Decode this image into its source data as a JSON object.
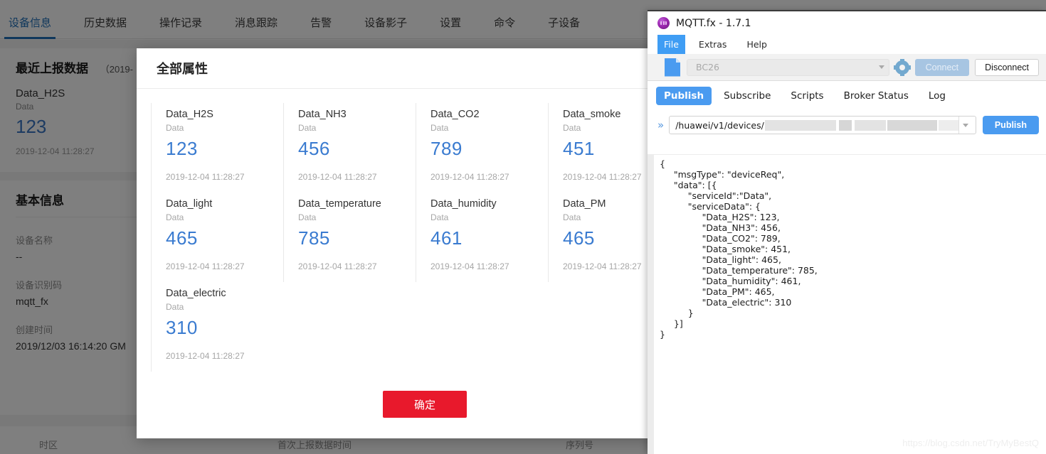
{
  "console": {
    "tabs": [
      {
        "label": "设备信息",
        "active": true
      },
      {
        "label": "历史数据",
        "active": false
      },
      {
        "label": "操作记录",
        "active": false
      },
      {
        "label": "消息跟踪",
        "active": false
      },
      {
        "label": "告警",
        "active": false
      },
      {
        "label": "设备影子",
        "active": false
      },
      {
        "label": "设置",
        "active": false
      },
      {
        "label": "命令",
        "active": false
      },
      {
        "label": "子设备",
        "active": false
      }
    ],
    "recent_title": "最近上报数据",
    "recent_subtitle": "（2019-",
    "recent_metric": {
      "name": "Data_H2S",
      "service": "Data",
      "value": "123",
      "time": "2019-12-04 11:28:27"
    },
    "basic_title": "基本信息",
    "basic_fields": [
      {
        "key": "设备名称",
        "value": "--"
      },
      {
        "key": "设备识别码",
        "value": "mqtt_fx"
      },
      {
        "key": "创建时间",
        "value": "2019/12/03 16:14:20 GM"
      }
    ],
    "bottom_keys": [
      "时区",
      "首次上报数据时间",
      "序列号"
    ]
  },
  "modal": {
    "title": "全部属性",
    "confirm_label": "确定",
    "properties": [
      {
        "name": "Data_H2S",
        "service": "Data",
        "value": "123",
        "time": "2019-12-04 11:28:27"
      },
      {
        "name": "Data_NH3",
        "service": "Data",
        "value": "456",
        "time": "2019-12-04 11:28:27"
      },
      {
        "name": "Data_CO2",
        "service": "Data",
        "value": "789",
        "time": "2019-12-04 11:28:27"
      },
      {
        "name": "Data_smoke",
        "service": "Data",
        "value": "451",
        "time": "2019-12-04 11:28:27"
      },
      {
        "name": "Data_light",
        "service": "Data",
        "value": "465",
        "time": "2019-12-04 11:28:27"
      },
      {
        "name": "Data_temperature",
        "service": "Data",
        "value": "785",
        "time": "2019-12-04 11:28:27"
      },
      {
        "name": "Data_humidity",
        "service": "Data",
        "value": "461",
        "time": "2019-12-04 11:28:27"
      },
      {
        "name": "Data_PM",
        "service": "Data",
        "value": "465",
        "time": "2019-12-04 11:28:27"
      },
      {
        "name": "Data_electric",
        "service": "Data",
        "value": "310",
        "time": "2019-12-04 11:28:27"
      }
    ]
  },
  "mqttfx": {
    "window_title": "MQTT.fx - 1.7.1",
    "menu": [
      {
        "label": "File",
        "selected": true
      },
      {
        "label": "Extras",
        "selected": false
      },
      {
        "label": "Help",
        "selected": false
      }
    ],
    "broker_profile": "BC26",
    "connect_label": "Connect",
    "disconnect_label": "Disconnect",
    "tabs": [
      {
        "label": "Publish",
        "selected": true
      },
      {
        "label": "Subscribe",
        "selected": false
      },
      {
        "label": "Scripts",
        "selected": false
      },
      {
        "label": "Broker Status",
        "selected": false
      },
      {
        "label": "Log",
        "selected": false
      }
    ],
    "topic": "/huawei/v1/devices/",
    "publish_label": "Publish",
    "payload": "{\n     \"msgType\": \"deviceReq\",\n     \"data\": [{\n          \"serviceId\":\"Data\",\n          \"serviceData\": {\n               \"Data_H2S\": 123,\n               \"Data_NH3\": 456,\n               \"Data_CO2\": 789,\n               \"Data_smoke\": 451,\n               \"Data_light\": 465,\n               \"Data_temperature\": 785,\n               \"Data_humidity\": 461,\n               \"Data_PM\": 465,\n               \"Data_electric\": 310\n          }\n     }]\n}"
  },
  "watermark": "https://blog.csdn.net/TryMyBestQ",
  "colors": {
    "accent_blue": "#1f6fb8",
    "value_blue": "#3a7bd0",
    "confirm_red": "#e8192c",
    "mqtt_blue": "#4a9bf0"
  }
}
